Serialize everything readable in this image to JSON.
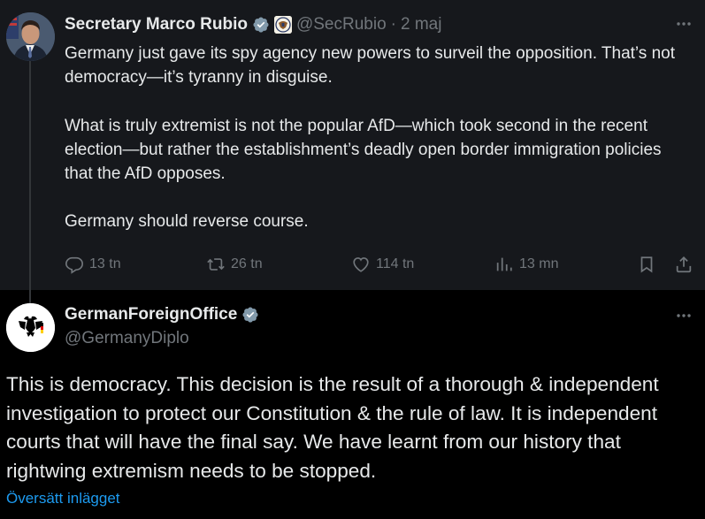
{
  "parent_tweet": {
    "author_name": "Secretary Marco Rubio",
    "handle": "@SecRubio",
    "separator": "·",
    "date": "2 maj",
    "paragraphs": [
      "Germany just gave its spy agency new powers to surveil the opposition. That’s not democracy—it’s tyranny in disguise.",
      "What is truly extremist is not the popular AfD—which took second in the recent election—but rather the establishment’s deadly open border immigration policies that the AfD opposes.",
      "Germany should reverse course."
    ],
    "actions": {
      "replies": "13 tn",
      "reposts": "26 tn",
      "likes": "114 tn",
      "views": "13 mn"
    }
  },
  "reply_tweet": {
    "author_name": "GermanForeignOffice",
    "handle": "@GermanyDiplo",
    "text": "This is democracy. This decision is the result of a thorough & independent investigation to protect our Constitution & the rule of law. It is independent courts that will have the final say. We have learnt from our history that rightwing extremism needs to be stopped.",
    "translate_link": "Översätt inlägget"
  },
  "icons": {
    "verified": "verified-badge-icon",
    "seal": "government-seal-icon",
    "more": "more-options-icon",
    "reply": "reply-icon",
    "repost": "repost-icon",
    "like": "heart-icon",
    "views": "views-chart-icon",
    "bookmark": "bookmark-icon",
    "share": "share-icon"
  },
  "colors": {
    "background": "#000000",
    "parent_background": "#16181c",
    "text": "#e7e9ea",
    "secondary_text": "#71767b",
    "link": "#1d9bf0",
    "verified": "#829aab"
  }
}
